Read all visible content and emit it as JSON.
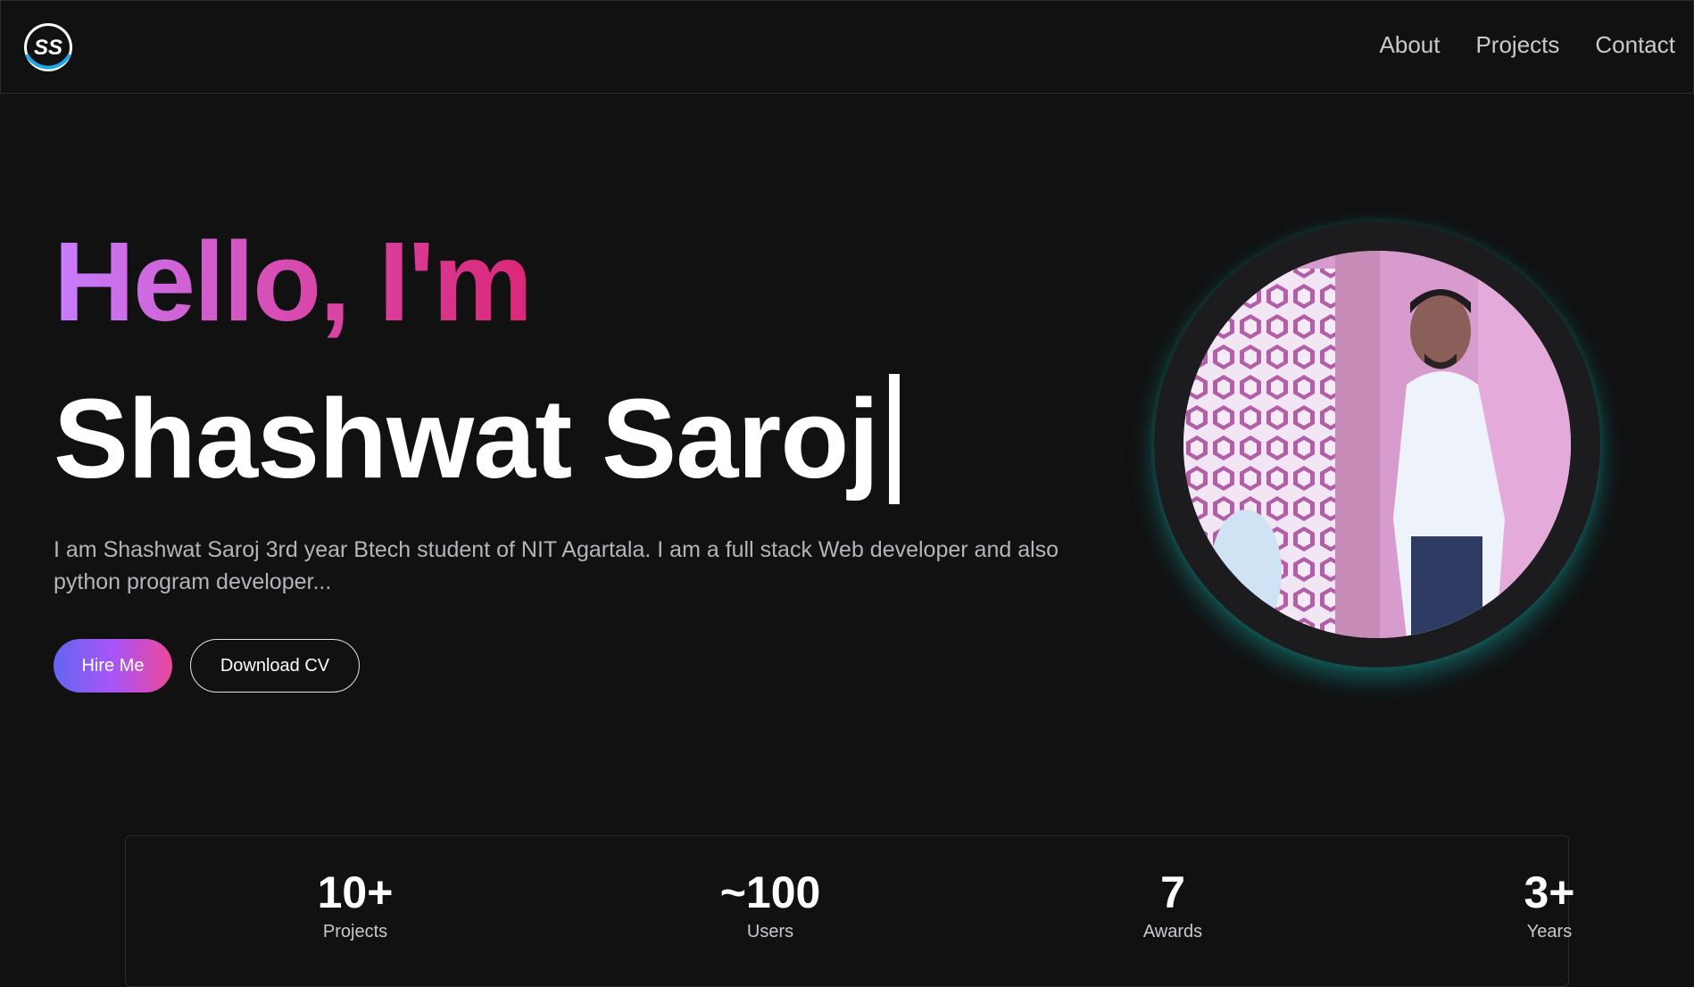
{
  "nav": {
    "logo_text": "SS",
    "links": [
      "About",
      "Projects",
      "Contact"
    ]
  },
  "hero": {
    "greeting": "Hello, I'm",
    "name": "Shashwat Saroj",
    "bio": "I am Shashwat Saroj 3rd year Btech student of NIT Agartala. I am a full stack Web developer and also python program developer...",
    "hire_label": "Hire Me",
    "cv_label": "Download CV"
  },
  "stats": [
    {
      "value": "10+",
      "label": "Projects"
    },
    {
      "value": "~100",
      "label": "Users"
    },
    {
      "value": "7",
      "label": "Awards"
    },
    {
      "value": "3+",
      "label": "Years"
    }
  ],
  "colors": {
    "background": "#111112",
    "accent_gradient_start": "#c77dff",
    "accent_gradient_end": "#db2777",
    "ring_glow": "#14b8b4"
  }
}
